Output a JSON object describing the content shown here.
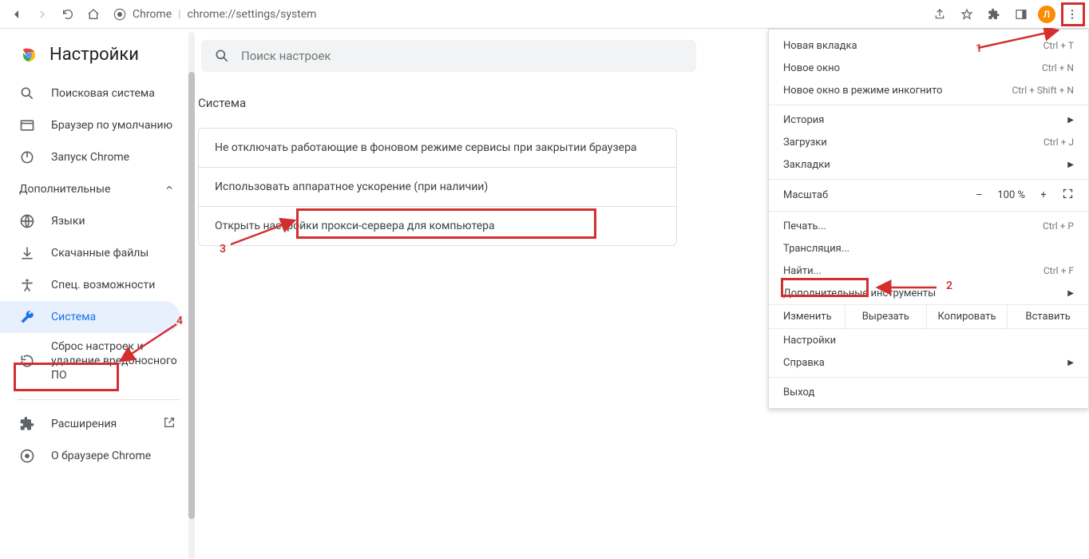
{
  "toolbar": {
    "chrome_label": "Chrome",
    "url": "chrome://settings/system",
    "avatar_letter": "Л"
  },
  "sidebar": {
    "title": "Настройки",
    "items_top": [
      {
        "label": "Поисковая система",
        "icon": "search"
      },
      {
        "label": "Браузер по умолчанию",
        "icon": "browser"
      },
      {
        "label": "Запуск Chrome",
        "icon": "power"
      }
    ],
    "adv_header": "Дополнительные",
    "items_adv": [
      {
        "label": "Языки",
        "icon": "globe"
      },
      {
        "label": "Скачанные файлы",
        "icon": "download"
      },
      {
        "label": "Спец. возможности",
        "icon": "accessibility"
      },
      {
        "label": "Система",
        "icon": "wrench",
        "active": true
      },
      {
        "label": "Сброс настроек и удаление вредоносного ПО",
        "icon": "reset"
      }
    ],
    "extensions": "Расширения",
    "about": "О браузере Chrome"
  },
  "content": {
    "search_placeholder": "Поиск настроек",
    "section_title": "Система",
    "rows": [
      "Не отключать работающие в фоновом режиме сервисы при закрытии браузера",
      "Использовать аппаратное ускорение (при наличии)",
      "Открыть настройки прокси-сервера для компьютера"
    ]
  },
  "menu": {
    "new_tab": "Новая вкладка",
    "new_tab_sc": "Ctrl + T",
    "new_window": "Новое окно",
    "new_window_sc": "Ctrl + N",
    "incognito": "Новое окно в режиме инкогнито",
    "incognito_sc": "Ctrl + Shift + N",
    "history": "История",
    "downloads": "Загрузки",
    "downloads_sc": "Ctrl + J",
    "bookmarks": "Закладки",
    "zoom_label": "Масштаб",
    "zoom_value": "100 %",
    "zoom_minus": "–",
    "zoom_plus": "+",
    "print": "Печать...",
    "print_sc": "Ctrl + P",
    "cast": "Трансляция...",
    "find": "Найти...",
    "find_sc": "Ctrl + F",
    "more_tools": "Дополнительные инструменты",
    "edit_label": "Изменить",
    "cut": "Вырезать",
    "copy": "Копировать",
    "paste": "Вставить",
    "settings": "Настройки",
    "help": "Справка",
    "exit": "Выход"
  },
  "annotations": {
    "n1": "1",
    "n2": "2",
    "n3": "3",
    "n4": "4"
  }
}
